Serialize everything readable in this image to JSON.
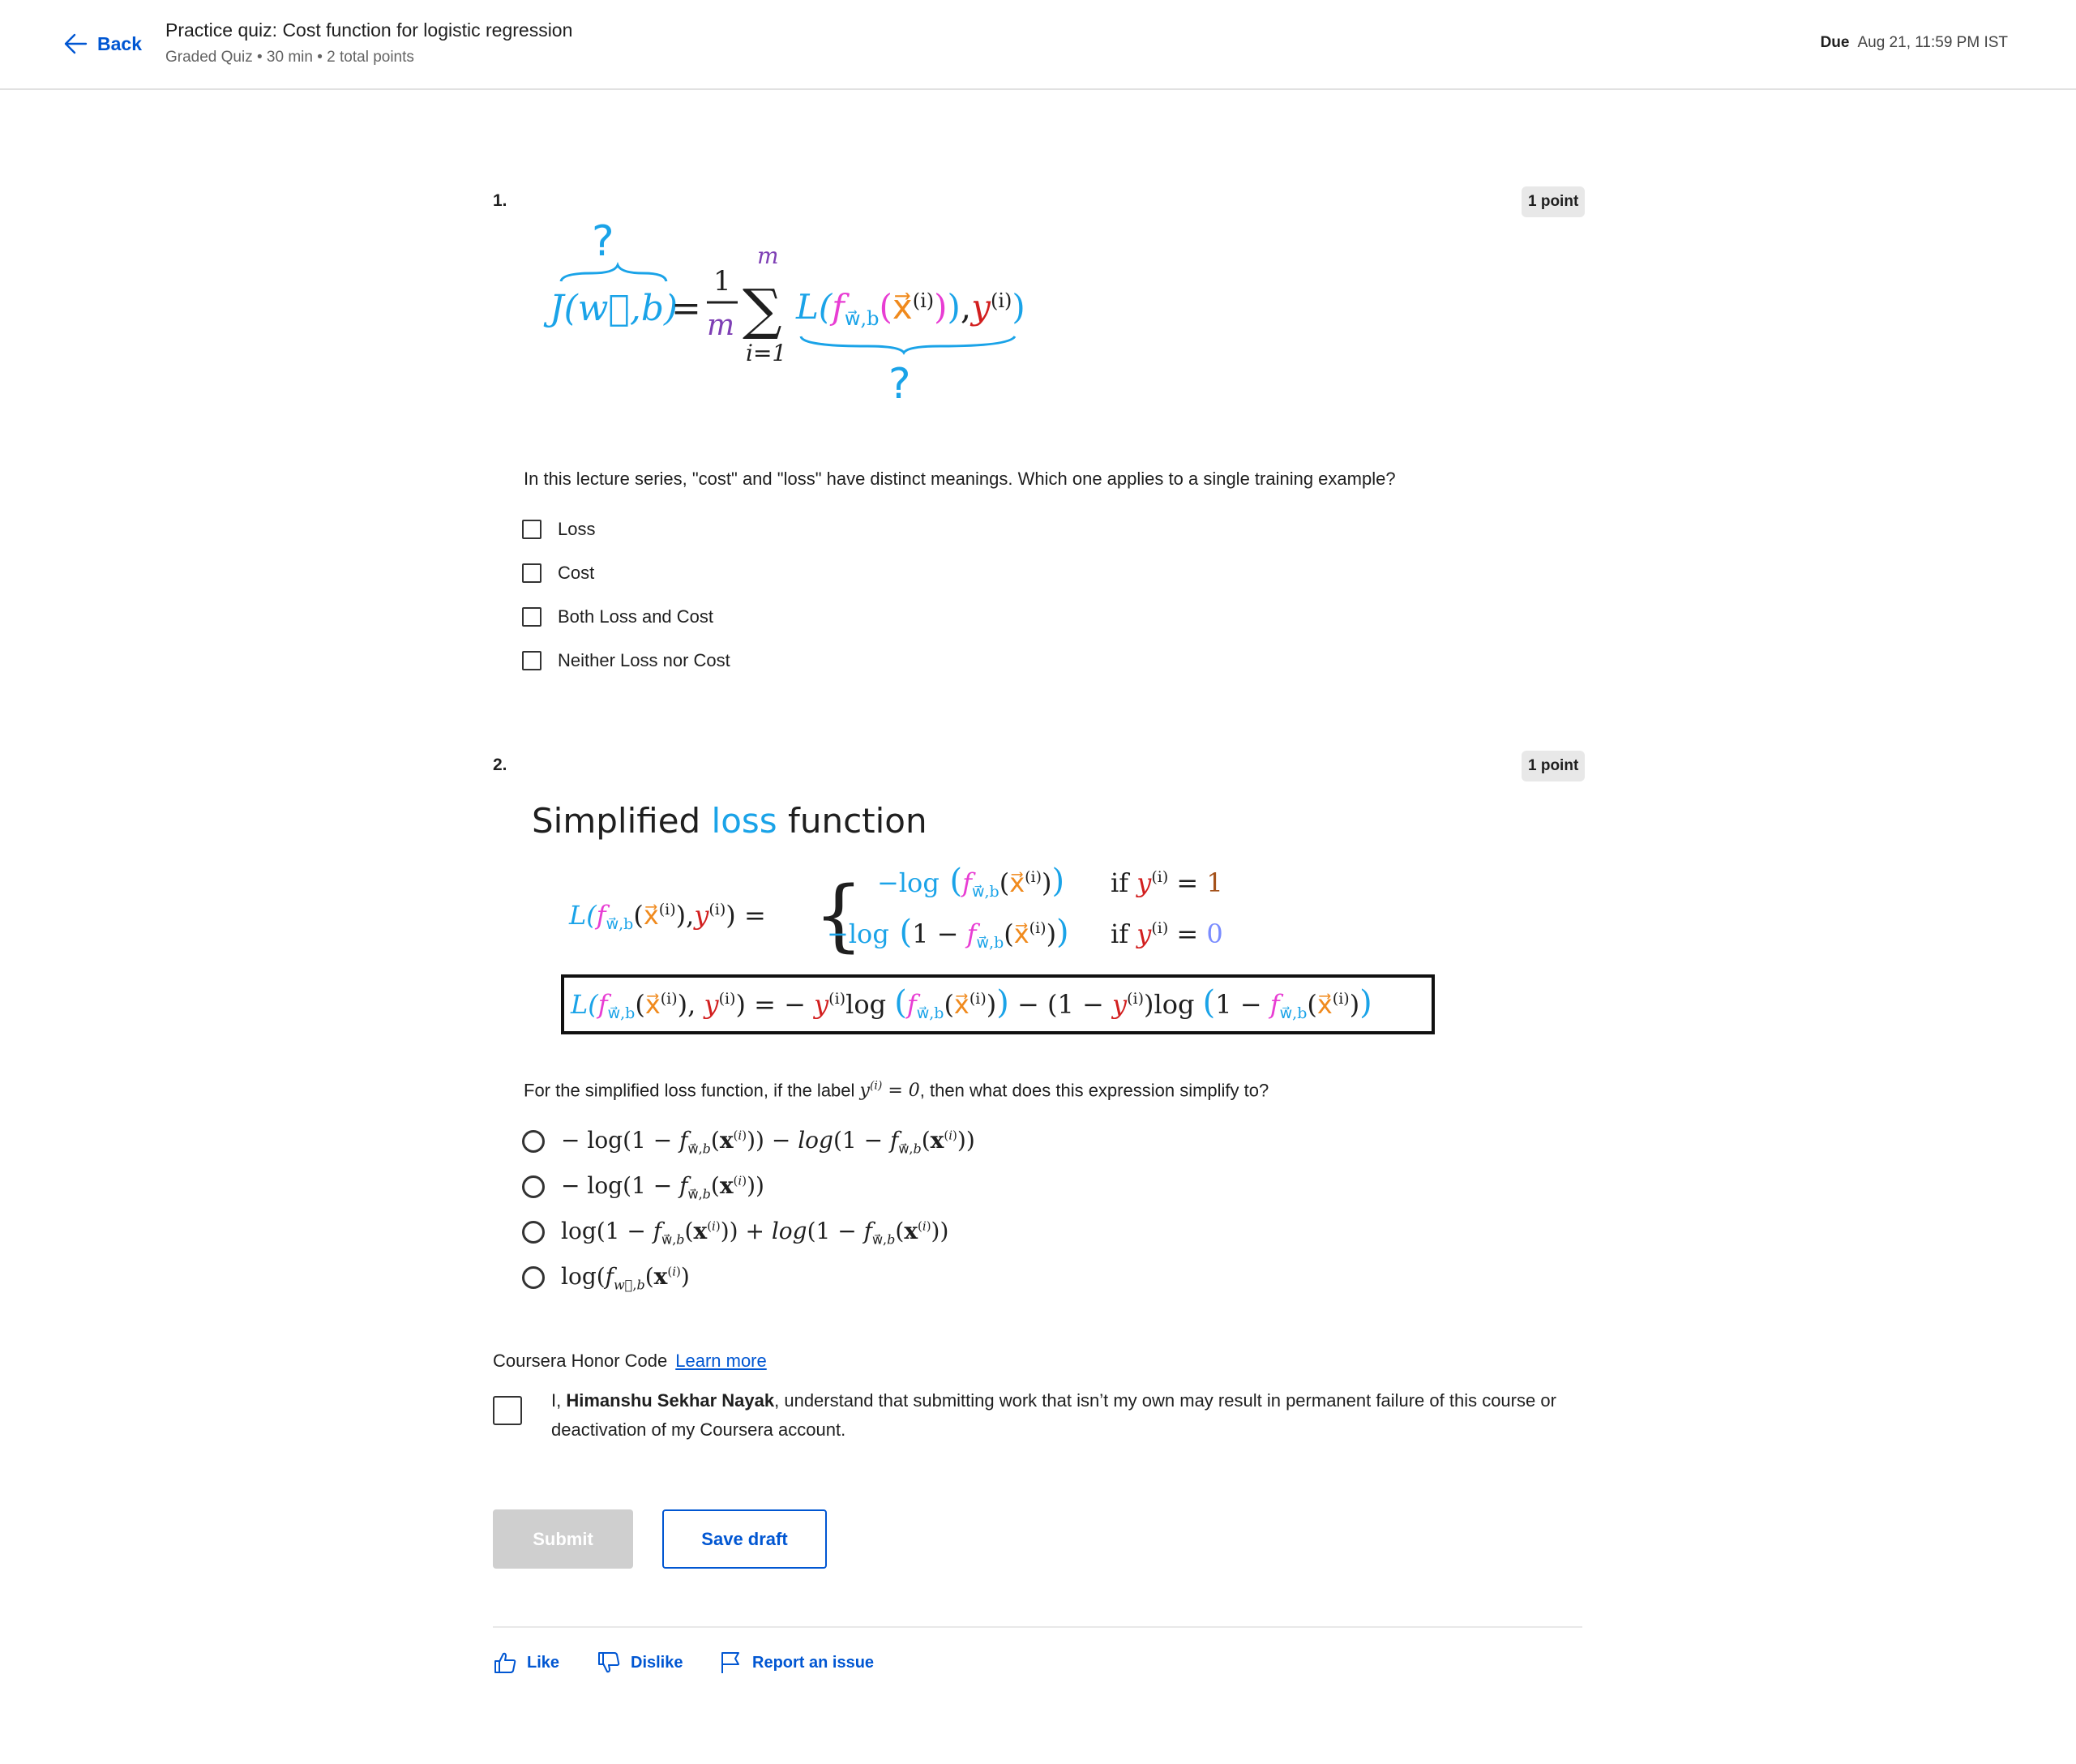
{
  "header": {
    "back_label": "Back",
    "title": "Practice quiz: Cost function for logistic regression",
    "subtitle": "Graded Quiz • 30 min • 2 total points",
    "due_label": "Due",
    "due_value": "Aug 21, 11:59 PM IST"
  },
  "q1": {
    "number": "1.",
    "points": "1 point",
    "question": "In this lecture series, \"cost\" and \"loss\" have distinct meanings. Which one applies to a single training example?",
    "options": [
      "Loss",
      "Cost",
      "Both Loss and Cost",
      "Neither Loss nor Cost"
    ]
  },
  "q2": {
    "number": "2.",
    "points": "1 point",
    "figure_title_a": "Simplified ",
    "figure_title_b": "loss",
    "figure_title_c": " function",
    "question_a": "For the simplified loss function, if the label ",
    "question_b": ", then what does this expression simplify to?"
  },
  "honor": {
    "title": "Coursera Honor Code",
    "learn_more": "Learn more",
    "text_prefix": "I, ",
    "name": "Himanshu Sekhar Nayak",
    "text_suffix": ", understand that submitting work that isn’t my own may result in permanent failure of this course or deactivation of my Coursera account."
  },
  "actions": {
    "submit": "Submit",
    "save_draft": "Save draft"
  },
  "feedback": {
    "like": "Like",
    "dislike": "Dislike",
    "report": "Report an issue"
  },
  "colors": {
    "link_blue": "#0056d2",
    "formula_blue": "#1aa3e8",
    "formula_purple": "#7e3fb5",
    "formula_magenta": "#e83dd3",
    "formula_orange": "#f08a1d",
    "formula_red": "#d21f1f"
  },
  "icons": [
    "arrow-left-icon",
    "thumbs-up-icon",
    "thumbs-down-icon",
    "flag-icon"
  ]
}
